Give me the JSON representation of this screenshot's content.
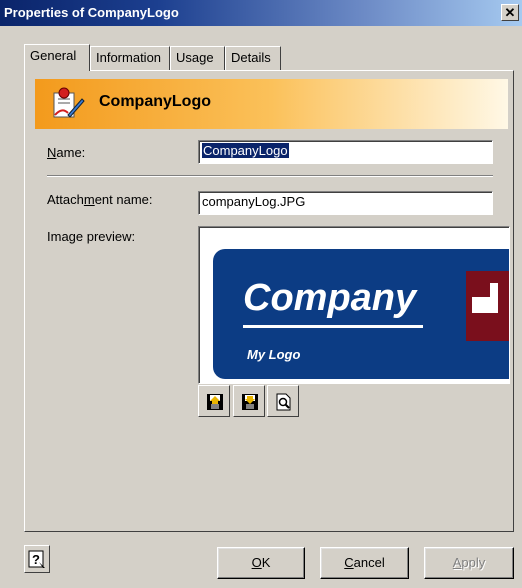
{
  "window": {
    "title": "Properties of CompanyLogo",
    "close_glyph": "✕"
  },
  "tabs": [
    {
      "label": "General",
      "active": true
    },
    {
      "label": "Information",
      "active": false
    },
    {
      "label": "Usage",
      "active": false
    },
    {
      "label": "Details",
      "active": false
    }
  ],
  "header": {
    "title": "CompanyLogo",
    "icon": "attachment-properties-icon"
  },
  "form": {
    "name_label_accel": "N",
    "name_label_rest": "ame:",
    "name_value": "CompanyLogo",
    "attachment_label_pre": "Attach",
    "attachment_label_accel": "m",
    "attachment_label_post": "ent name:",
    "attachment_value": "companyLog.JPG",
    "preview_label": "Image preview:"
  },
  "preview": {
    "logo_title": "Company",
    "logo_subtitle": "My Logo",
    "colors": {
      "card": "#0c3c84",
      "mark": "#7a0f1c"
    }
  },
  "toolbar": {
    "buttons": [
      {
        "name": "open-image-icon"
      },
      {
        "name": "save-image-icon"
      },
      {
        "name": "view-image-icon"
      }
    ]
  },
  "footer": {
    "ok_accel": "O",
    "ok_rest": "K",
    "cancel_accel": "C",
    "cancel_rest": "ancel",
    "apply_accel": "A",
    "apply_rest": "pply",
    "help_icon": "help-icon"
  },
  "colors": {
    "face": "#d4d0c8",
    "title_start": "#0a246a",
    "title_end": "#a6caf0",
    "banner": "#f39a1c"
  }
}
